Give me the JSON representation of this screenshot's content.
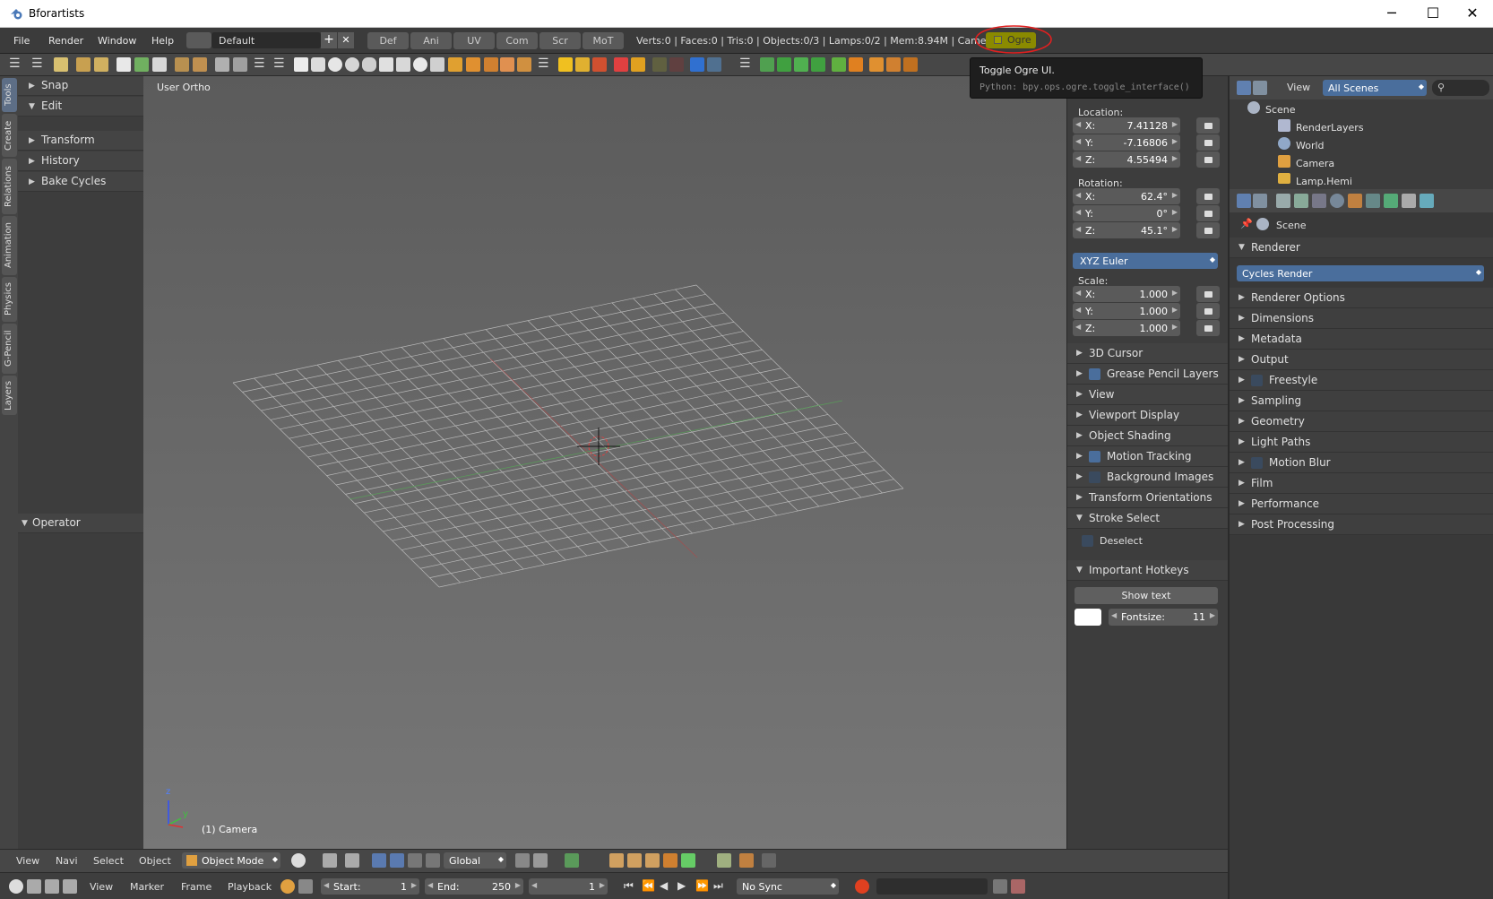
{
  "window": {
    "title": "Bforartists"
  },
  "menu": {
    "items": [
      "File",
      "Render",
      "Window",
      "Help"
    ],
    "layout": "Default",
    "tabs": [
      "Def",
      "Ani",
      "UV",
      "Com",
      "Scr",
      "MoT"
    ],
    "stats": "Verts:0 | Faces:0 | Tris:0 | Objects:0/3 | Lamps:0/2 | Mem:8.94M | Camera",
    "ogre_button": "Ogre"
  },
  "tooltip": {
    "title": "Toggle Ogre UI.",
    "python": "Python: bpy.ops.ogre.toggle_interface()"
  },
  "lefttabs": [
    "Tools",
    "Create",
    "Relations",
    "Animation",
    "Physics",
    "G-Pencil",
    "Layers"
  ],
  "toolshelf": {
    "panels": [
      "Snap",
      "Edit",
      "Transform",
      "History",
      "Bake Cycles"
    ],
    "operator": "Operator"
  },
  "viewport": {
    "view_label": "User Ortho",
    "object_label": "(1) Camera",
    "axis_z": "z",
    "axis_y": "y"
  },
  "npanel": {
    "location_label": "Location:",
    "location": [
      {
        "k": "X:",
        "v": "7.41128"
      },
      {
        "k": "Y:",
        "v": "-7.16806"
      },
      {
        "k": "Z:",
        "v": "4.55494"
      }
    ],
    "rotation_label": "Rotation:",
    "rotation": [
      {
        "k": "X:",
        "v": "62.4°"
      },
      {
        "k": "Y:",
        "v": "0°"
      },
      {
        "k": "Z:",
        "v": "45.1°"
      }
    ],
    "rotation_mode": "XYZ Euler",
    "scale_label": "Scale:",
    "scale": [
      {
        "k": "X:",
        "v": "1.000"
      },
      {
        "k": "Y:",
        "v": "1.000"
      },
      {
        "k": "Z:",
        "v": "1.000"
      }
    ],
    "panels": [
      {
        "label": "3D Cursor",
        "check": false,
        "open": false
      },
      {
        "label": "Grease Pencil Layers",
        "check": true,
        "checked": true,
        "open": false
      },
      {
        "label": "View",
        "check": false,
        "open": false
      },
      {
        "label": "Viewport Display",
        "check": false,
        "open": false
      },
      {
        "label": "Object Shading",
        "check": false,
        "open": false
      },
      {
        "label": "Motion Tracking",
        "check": true,
        "checked": true,
        "open": false
      },
      {
        "label": "Background Images",
        "check": true,
        "checked": false,
        "open": false
      },
      {
        "label": "Transform Orientations",
        "check": false,
        "open": false
      },
      {
        "label": "Stroke Select",
        "check": false,
        "open": true
      }
    ],
    "deselect": "Deselect",
    "hotkeys": "Important Hotkeys",
    "show_text": "Show text",
    "fontsize_label": "Fontsize:",
    "fontsize_value": "11"
  },
  "outliner": {
    "view": "View",
    "filter": "All Scenes",
    "items": [
      "Scene",
      "RenderLayers",
      "World",
      "Camera",
      "Lamp.Hemi"
    ]
  },
  "properties": {
    "context": "Scene",
    "renderer_panel": "Renderer",
    "engine": "Cycles Render",
    "panels": [
      {
        "label": "Renderer Options",
        "check": false
      },
      {
        "label": "Dimensions",
        "check": false
      },
      {
        "label": "Metadata",
        "check": false
      },
      {
        "label": "Output",
        "check": false
      },
      {
        "label": "Freestyle",
        "check": true
      },
      {
        "label": "Sampling",
        "check": false
      },
      {
        "label": "Geometry",
        "check": false
      },
      {
        "label": "Light Paths",
        "check": false
      },
      {
        "label": "Motion Blur",
        "check": true
      },
      {
        "label": "Film",
        "check": false
      },
      {
        "label": "Performance",
        "check": false
      },
      {
        "label": "Post Processing",
        "check": false
      }
    ]
  },
  "header3d": {
    "items": [
      "View",
      "Navi",
      "Select",
      "Object"
    ],
    "mode": "Object Mode",
    "orientation": "Global"
  },
  "timeline": {
    "items": [
      "View",
      "Marker",
      "Frame",
      "Playback"
    ],
    "start_label": "Start:",
    "start": "1",
    "end_label": "End:",
    "end": "250",
    "current": "1",
    "sync": "No Sync"
  },
  "colors": {
    "accent": "#5680c2",
    "ogre": "#8a8a00",
    "highlight": "#e02020"
  }
}
